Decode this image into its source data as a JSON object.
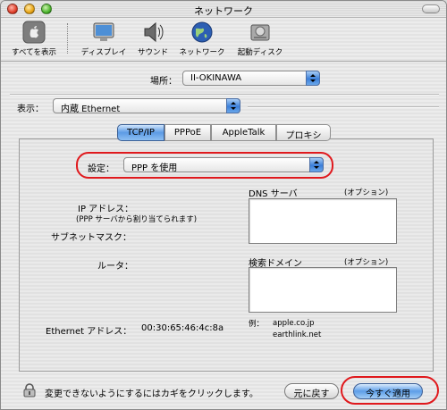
{
  "window": {
    "title": "ネットワーク"
  },
  "toolbar": {
    "items": [
      {
        "label": "すべてを表示",
        "icon": "apple-icon"
      },
      {
        "label": "ディスプレイ",
        "icon": "display-icon"
      },
      {
        "label": "サウンド",
        "icon": "speaker-icon"
      },
      {
        "label": "ネットワーク",
        "icon": "globe-icon"
      },
      {
        "label": "起動ディスク",
        "icon": "disk-icon"
      }
    ]
  },
  "location": {
    "label": "場所：",
    "value": "II-OKINAWA"
  },
  "show": {
    "label": "表示：",
    "value": "内蔵 Ethernet"
  },
  "tabs": [
    {
      "label": "TCP/IP",
      "active": true
    },
    {
      "label": "PPPoE",
      "active": false
    },
    {
      "label": "AppleTalk",
      "active": false
    },
    {
      "label": "プロキシ",
      "active": false
    }
  ],
  "configure": {
    "label": "設定：",
    "value": "PPP を使用"
  },
  "ip": {
    "label": "IP アドレス：",
    "note": "(PPP サーバから割り当てられます)"
  },
  "subnet": {
    "label": "サブネットマスク："
  },
  "router": {
    "label": "ルータ："
  },
  "dns": {
    "label": "DNS サーバ",
    "optional": "(オプション)",
    "value": ""
  },
  "search_domains": {
    "label": "検索ドメイン",
    "optional": "(オプション)",
    "value": ""
  },
  "example": {
    "label": "例：",
    "line1": "apple.co.jp",
    "line2": "earthlink.net"
  },
  "ethernet": {
    "label": "Ethernet アドレス：",
    "value": "00:30:65:46:4c:8a"
  },
  "footer": {
    "lock_text": "変更できないようにするにはカギをクリックします。",
    "revert_button": "元に戻す",
    "apply_button": "今すぐ適用"
  },
  "colors": {
    "annotation_red": "#e0191d",
    "aqua_blue": "#3b7fd9"
  }
}
